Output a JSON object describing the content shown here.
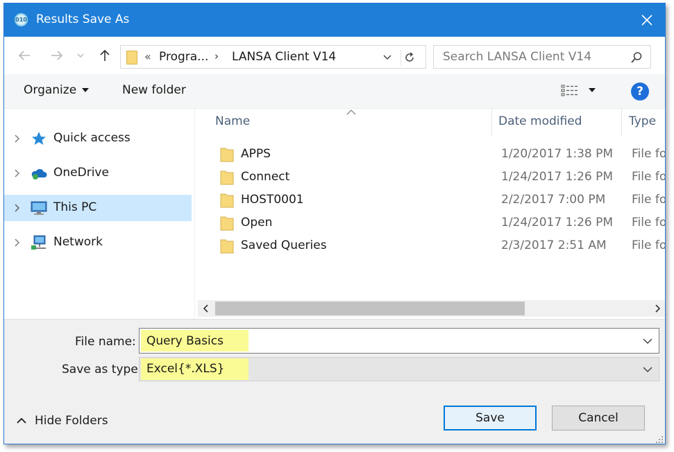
{
  "window": {
    "title": "Results Save As",
    "icon": "app-icon",
    "icon_text": "010"
  },
  "address": {
    "overflow_marker": "«",
    "crumbs": [
      "Progra...",
      "LANSA Client V14"
    ],
    "separator": "›"
  },
  "search": {
    "placeholder": "Search LANSA Client V14"
  },
  "toolbar": {
    "organize_label": "Organize",
    "new_folder_label": "New folder",
    "help_label": "?"
  },
  "nav_pane": {
    "items": [
      {
        "label": "Quick access",
        "icon": "star-icon"
      },
      {
        "label": "OneDrive",
        "icon": "cloud-icon"
      },
      {
        "label": "This PC",
        "icon": "computer-icon",
        "selected": true
      },
      {
        "label": "Network",
        "icon": "network-icon"
      }
    ]
  },
  "file_list": {
    "columns": [
      "Name",
      "Date modified",
      "Type"
    ],
    "rows": [
      {
        "name": "APPS",
        "date": "1/20/2017 1:38 PM",
        "type": "File folder"
      },
      {
        "name": "Connect",
        "date": "1/24/2017 1:26 PM",
        "type": "File folder"
      },
      {
        "name": "HOST0001",
        "date": "2/2/2017 7:00 PM",
        "type": "File folder"
      },
      {
        "name": "Open",
        "date": "1/24/2017 1:26 PM",
        "type": "File folder"
      },
      {
        "name": "Saved Queries",
        "date": "2/3/2017 2:51 AM",
        "type": "File folder"
      }
    ]
  },
  "form": {
    "file_name_label": "File name:",
    "file_name_value": "Query Basics",
    "save_type_label": "Save as type:",
    "save_type_value": "Excel{*.XLS}"
  },
  "footer": {
    "hide_folders_label": "Hide Folders",
    "save_label": "Save",
    "cancel_label": "Cancel"
  },
  "colors": {
    "titlebar": "#1f7fd8",
    "selection": "#cce8ff",
    "highlight": "#fbfb95",
    "help": "#1e6fd9",
    "folder": "#f7d87a"
  }
}
